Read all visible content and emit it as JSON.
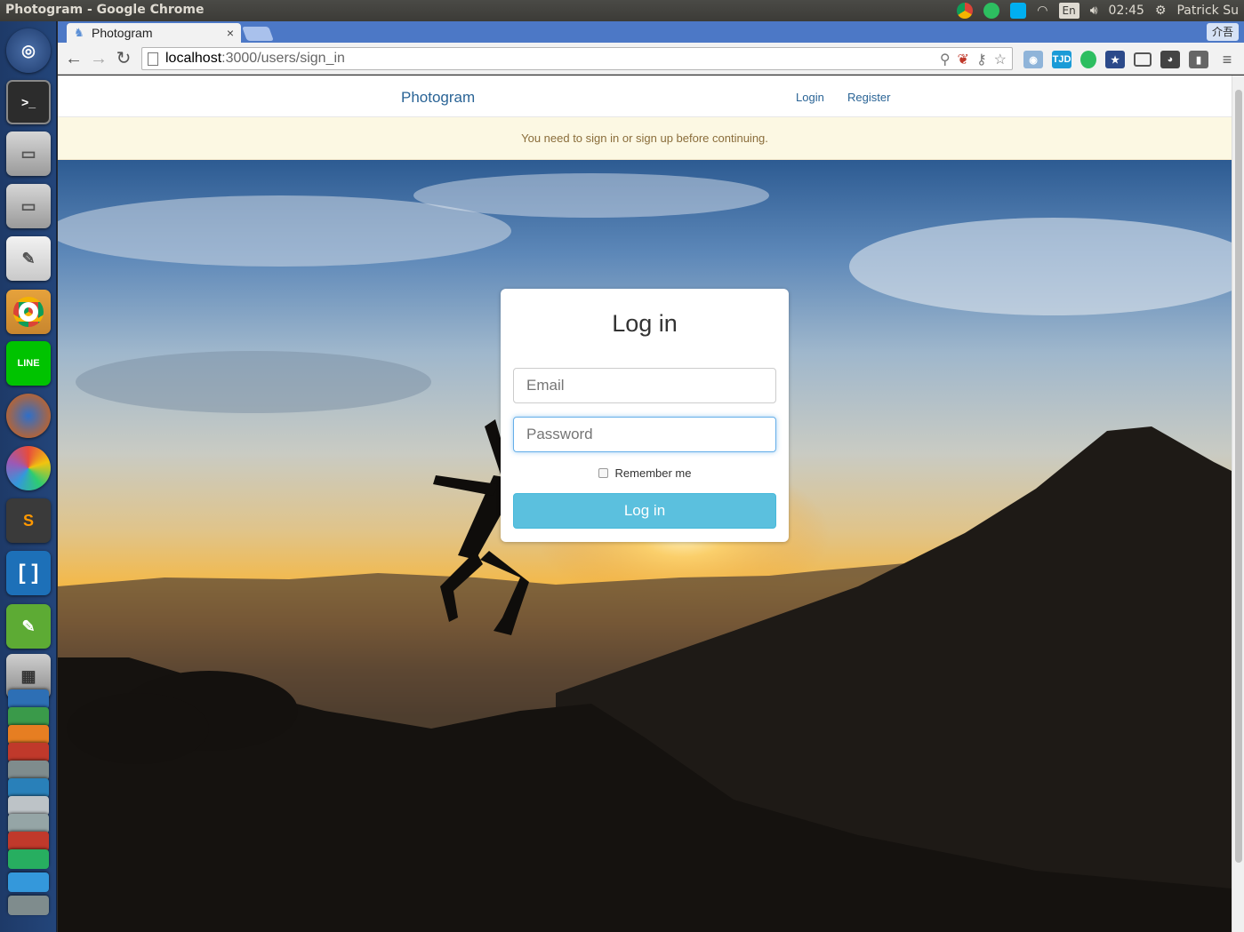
{
  "os": {
    "window_title": "Photogram - Google Chrome",
    "ime": "En",
    "clock": "02:45",
    "user": "Patrick Su"
  },
  "browser": {
    "tab_title": "Photogram",
    "tab_close": "×",
    "profile_label": "介吾",
    "url_host": "localhost",
    "url_path": ":3000/users/sign_in"
  },
  "site": {
    "brand": "Photogram",
    "nav_login": "Login",
    "nav_register": "Register",
    "alert": "You need to sign in or sign up before continuing."
  },
  "login_form": {
    "title": "Log in",
    "email_placeholder": "Email",
    "password_placeholder": "Password",
    "remember_label": "Remember me",
    "submit_label": "Log in"
  },
  "launcher_apps": [
    "ubuntu-dash",
    "terminal",
    "files",
    "files",
    "text-editor",
    "chrome",
    "line",
    "firefox",
    "paint",
    "sublime-text",
    "brackets",
    "notes",
    "calculator"
  ],
  "colors": {
    "link": "#2a6496",
    "alert_bg": "#fcf8e3",
    "alert_text": "#8a6d3b",
    "button_info": "#5bc0de",
    "tabstrip": "#4c78c6"
  }
}
